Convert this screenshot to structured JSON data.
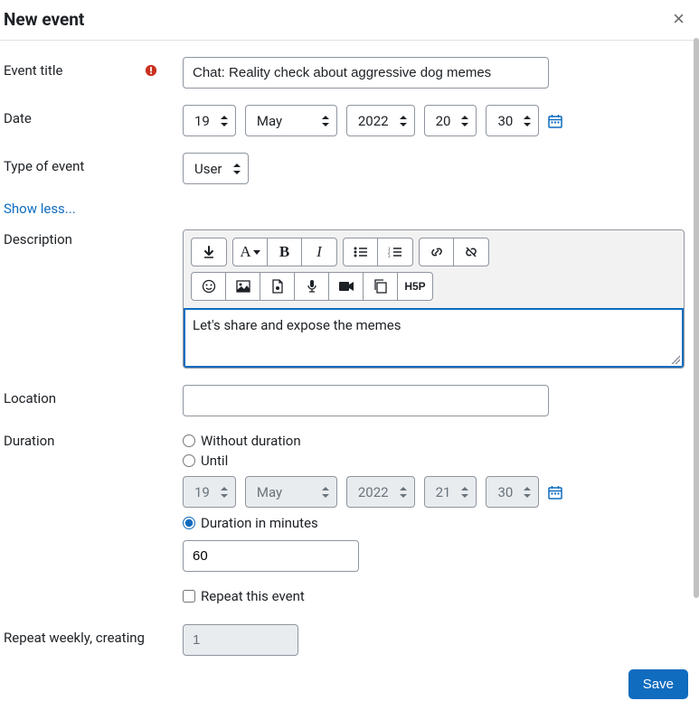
{
  "header": {
    "title": "New event"
  },
  "labels": {
    "event_title": "Event title",
    "date": "Date",
    "type_of_event": "Type of event",
    "show_less": "Show less...",
    "description": "Description",
    "location": "Location",
    "duration": "Duration",
    "without_duration": "Without duration",
    "until": "Until",
    "duration_minutes": "Duration in minutes",
    "repeat_this_event": "Repeat this event",
    "repeat_weekly": "Repeat weekly, creating",
    "save": "Save"
  },
  "values": {
    "title_input": "Chat: Reality check about aggressive dog memes",
    "date_day": "19",
    "date_month": "May",
    "date_year": "2022",
    "date_hour": "20",
    "date_minute": "30",
    "event_type": "User",
    "description_text": "Let's share and expose the memes",
    "location_input": "",
    "until_day": "19",
    "until_month": "May",
    "until_year": "2022",
    "until_hour": "21",
    "until_minute": "30",
    "duration_minutes_value": "60",
    "repeat_count": "1",
    "duration_choice": "minutes",
    "repeat_checked": false
  },
  "icons": {
    "required": "required-icon",
    "calendar": "calendar-icon"
  }
}
